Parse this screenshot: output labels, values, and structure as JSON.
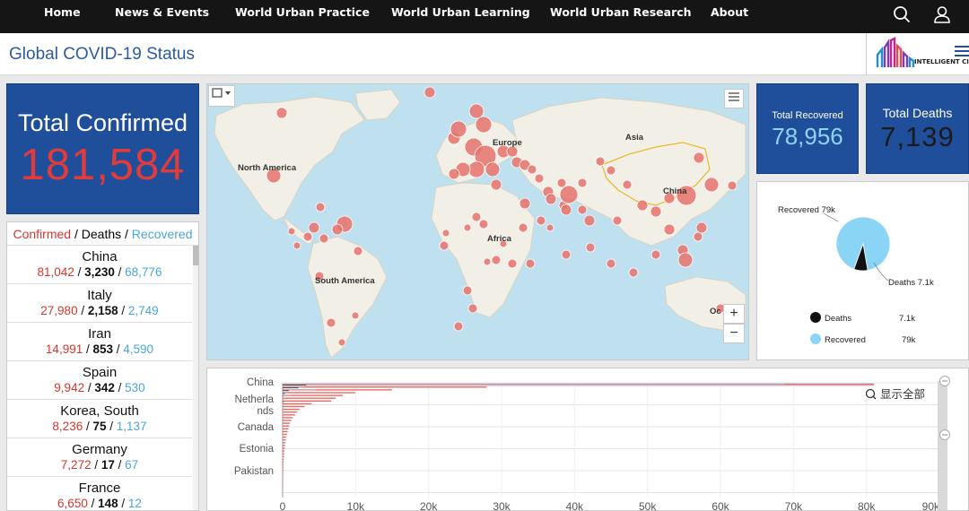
{
  "nav": {
    "items": [
      "Home",
      "News & Events",
      "World Urban Practice",
      "World Urban Learning",
      "World Urban Research",
      "About"
    ],
    "search_icon": "search-icon",
    "user_icon": "user-icon"
  },
  "header": {
    "title": "Global COVID-19 Status",
    "logo_text": "INTELLIGENT CI",
    "menu_icon": "hamburger-menu-icon"
  },
  "total_confirmed": {
    "label": "Total Confirmed",
    "value": "181,584"
  },
  "country_list": {
    "header": {
      "confirmed": "Confirmed",
      "sep1": " / ",
      "deaths": "Deaths",
      "sep2": " / ",
      "recovered": "Recovered"
    },
    "rows": [
      {
        "country": "China",
        "confirmed": "81,042",
        "deaths": "3,230",
        "recovered": "68,776"
      },
      {
        "country": "Italy",
        "confirmed": "27,980",
        "deaths": "2,158",
        "recovered": "2,749"
      },
      {
        "country": "Iran",
        "confirmed": "14,991",
        "deaths": "853",
        "recovered": "4,590"
      },
      {
        "country": "Spain",
        "confirmed": "9,942",
        "deaths": "342",
        "recovered": "530"
      },
      {
        "country": "Korea, South",
        "confirmed": "8,236",
        "deaths": "75",
        "recovered": "1,137"
      },
      {
        "country": "Germany",
        "confirmed": "7,272",
        "deaths": "17",
        "recovered": "67"
      },
      {
        "country": "France",
        "confirmed": "6,650",
        "deaths": "148",
        "recovered": "12"
      }
    ]
  },
  "map": {
    "labels": [
      "North America",
      "Europe",
      "Asia",
      "China",
      "Africa",
      "South America",
      "Oc"
    ],
    "zoom_in": "+",
    "zoom_out": "−",
    "colors": {
      "ocean": "#bfe1ef",
      "land": "#f2efe6",
      "point": "#e8726c"
    }
  },
  "total_recovered": {
    "label": "Total Recovered",
    "value": "78,956"
  },
  "total_deaths": {
    "label": "Total Deaths",
    "value": "7,139"
  },
  "chart_data": [
    {
      "type": "pie",
      "slices": [
        {
          "name": "Recovered",
          "value": 78956,
          "color": "#8ad4f6"
        },
        {
          "name": "Deaths",
          "value": 7139,
          "color": "#111111"
        }
      ],
      "slice_labels": [
        "Recovered 79k",
        "Deaths 7.1k"
      ],
      "legend": [
        {
          "name": "Deaths",
          "value": "7.1k",
          "color": "#111111"
        },
        {
          "name": "Recovered",
          "value": "79k",
          "color": "#8ad4f6"
        }
      ]
    },
    {
      "type": "bar",
      "orientation": "horizontal",
      "y_tick_labels": [
        "China",
        "Netherla\nnds",
        "Canada",
        "Estonia",
        "Pakistan"
      ],
      "x_ticks": [
        "0",
        "10k",
        "20k",
        "30k",
        "40k",
        "50k",
        "60k",
        "70k",
        "80k",
        "90k"
      ],
      "xlim": [
        0,
        90000
      ],
      "reset_zoom_label": "显示全部",
      "series": [
        {
          "values": [
            81042,
            27980,
            14991,
            9942,
            8236,
            7272,
            6650,
            4000,
            3000,
            2300,
            2000,
            1700,
            1400,
            1200,
            1000,
            900,
            800,
            700,
            600,
            500,
            450,
            400,
            350,
            300,
            250,
            200,
            180,
            160,
            140,
            120,
            100,
            90,
            80,
            70,
            60,
            50,
            40,
            30,
            20,
            10
          ]
        },
        {
          "values": [
            68776,
            2749,
            4590,
            530,
            1137,
            67,
            12
          ]
        },
        {
          "values": [
            3230,
            2158,
            853,
            342,
            75,
            17,
            148
          ]
        }
      ]
    }
  ]
}
